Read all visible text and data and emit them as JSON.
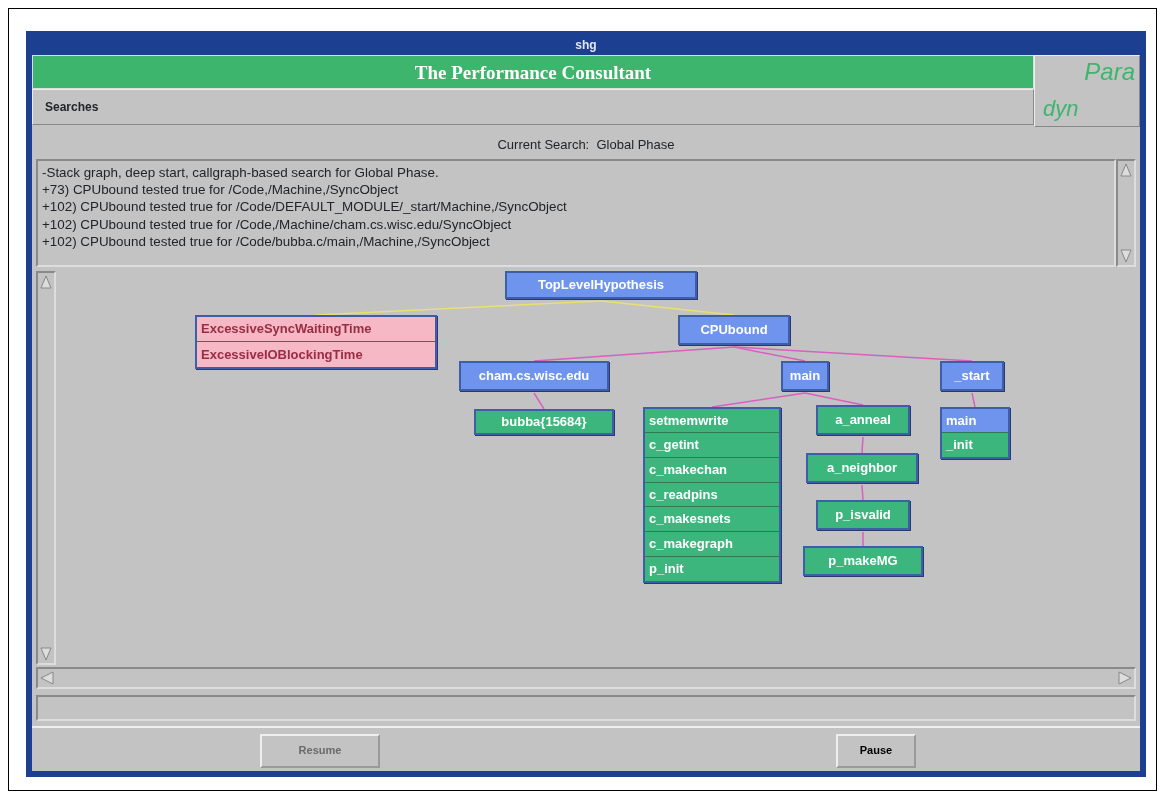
{
  "window": {
    "title": "shg"
  },
  "header": {
    "title": "The Performance Consultant",
    "logo_top": "Para",
    "logo_bottom": "dyn"
  },
  "menu": [
    "Searches"
  ],
  "current_search": {
    "label": "Current Search:",
    "value": "Global Phase"
  },
  "log": [
    "-Stack graph, deep start, callgraph-based search for Global Phase.",
    "+73) CPUbound tested true for /Code,/Machine,/SyncObject",
    "+102) CPUbound tested true for /Code/DEFAULT_MODULE/_start/Machine,/SyncObject",
    "+102) CPUbound tested true for /Code,/Machine/cham.cs.wisc.edu/SyncObject",
    "+102) CPUbound tested true for /Code/bubba.c/main,/Machine,/SyncObject"
  ],
  "graph": {
    "boxes": [
      {
        "label": "TopLevelHypothesis",
        "color": "#6f94ee"
      }
    ],
    "children": [
      {
        "boxes": [
          {
            "label": "ExcessiveSyncWaitingTime",
            "color": "#f5b8c4"
          },
          {
            "label": "ExcessiveIOBlockingTime",
            "color": "#f5b8c4"
          }
        ]
      },
      {
        "boxes": [
          {
            "label": "CPUbound",
            "color": "#6f94ee"
          }
        ],
        "children": [
          {
            "boxes": [
              {
                "label": "cham.cs.wisc.edu",
                "color": "#6f94ee"
              }
            ],
            "children": [
              {
                "boxes": [
                  {
                    "label": "bubba{15684}",
                    "color": "#3cb67c"
                  }
                ]
              }
            ]
          },
          {
            "boxes": [
              {
                "label": "main",
                "color": "#6f94ee"
              }
            ],
            "children": [
              {
                "boxes": [
                  {
                    "label": "setmemwrite",
                    "color": "#3cb67c"
                  },
                  {
                    "label": "c_getint",
                    "color": "#3cb67c"
                  },
                  {
                    "label": "c_makechan",
                    "color": "#3cb67c"
                  },
                  {
                    "label": "c_readpins",
                    "color": "#3cb67c"
                  },
                  {
                    "label": "c_makesnets",
                    "color": "#3cb67c"
                  },
                  {
                    "label": "c_makegraph",
                    "color": "#3cb67c"
                  },
                  {
                    "label": "p_init",
                    "color": "#3cb67c"
                  }
                ]
              },
              {
                "boxes": [
                  {
                    "label": "a_anneal",
                    "color": "#3cb67c"
                  }
                ],
                "children": [
                  {
                    "boxes": [
                      {
                        "label": "a_neighbor",
                        "color": "#3cb67c"
                      }
                    ],
                    "children": [
                      {
                        "boxes": [
                          {
                            "label": "p_isvalid",
                            "color": "#3cb67c"
                          }
                        ],
                        "children": [
                          {
                            "boxes": [
                              {
                                "label": "p_makeMG",
                                "color": "#3cb67c"
                              }
                            ]
                          }
                        ]
                      }
                    ]
                  }
                ]
              }
            ]
          },
          {
            "boxes": [
              {
                "label": "_start",
                "color": "#6f94ee"
              }
            ],
            "children": [
              {
                "boxes": [
                  {
                    "label": "main",
                    "color": "#6f94ee"
                  },
                  {
                    "label": "_init",
                    "color": "#3cb67c"
                  }
                ]
              }
            ]
          }
        ]
      }
    ]
  },
  "buttons": [
    {
      "label": "Resume",
      "disabled": true
    },
    {
      "label": "Pause",
      "disabled": false
    }
  ]
}
